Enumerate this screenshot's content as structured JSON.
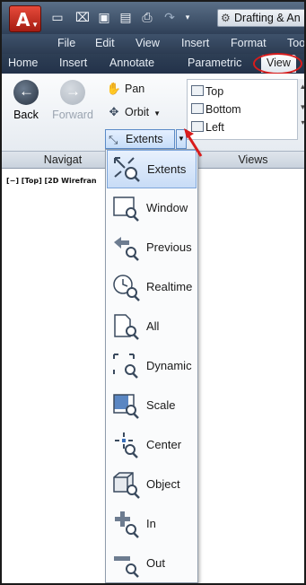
{
  "quick_access": {
    "workspace_label": "Drafting & An",
    "icons": [
      "new-icon",
      "open-icon",
      "save-icon",
      "saveas-icon",
      "print-icon",
      "redo-icon",
      "dropdown-icon",
      "gear-icon"
    ]
  },
  "menubar": {
    "items": [
      "File",
      "Edit",
      "View",
      "Insert",
      "Format",
      "Too"
    ]
  },
  "ribbon_tabs": {
    "items": [
      "Home",
      "Insert",
      "Annotate",
      "Parametric",
      "View"
    ],
    "active": "View"
  },
  "navigate_panel": {
    "back_label": "Back",
    "forward_label": "Forward",
    "pan_label": "Pan",
    "orbit_label": "Orbit",
    "extents_label": "Extents",
    "panel_title": "Navigat"
  },
  "views_panel": {
    "items": [
      "Top",
      "Bottom",
      "Left"
    ],
    "panel_title": "Views"
  },
  "viewport_label": "[−] [Top] [2D Wirefran",
  "zoom_menu": {
    "items": [
      {
        "label": "Extents",
        "icon": "zoom-extents-icon",
        "selected": true
      },
      {
        "label": "Window",
        "icon": "zoom-window-icon",
        "selected": false
      },
      {
        "label": "Previous",
        "icon": "zoom-previous-icon",
        "selected": false
      },
      {
        "label": "Realtime",
        "icon": "zoom-realtime-icon",
        "selected": false
      },
      {
        "label": "All",
        "icon": "zoom-all-icon",
        "selected": false
      },
      {
        "label": "Dynamic",
        "icon": "zoom-dynamic-icon",
        "selected": false
      },
      {
        "label": "Scale",
        "icon": "zoom-scale-icon",
        "selected": false
      },
      {
        "label": "Center",
        "icon": "zoom-center-icon",
        "selected": false
      },
      {
        "label": "Object",
        "icon": "zoom-object-icon",
        "selected": false
      },
      {
        "label": "In",
        "icon": "zoom-in-icon",
        "selected": false
      },
      {
        "label": "Out",
        "icon": "zoom-out-icon",
        "selected": false
      }
    ]
  },
  "colors": {
    "highlight_ring": "#d81c1c",
    "arrow": "#d81c1c",
    "selected_item": "#c8dcf6"
  }
}
